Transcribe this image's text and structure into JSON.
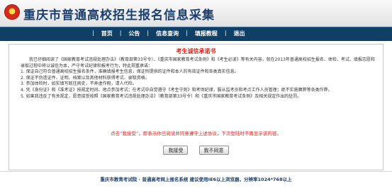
{
  "header": {
    "title": "重庆市普通高校招生报名信息采集"
  },
  "nav": {
    "items": [
      {
        "label": "首页"
      },
      {
        "label": "公告"
      },
      {
        "label": "信息查询"
      },
      {
        "label": "填报教程"
      },
      {
        "label": "退出"
      }
    ]
  },
  "notice": {
    "title": "考生诚信承诺书",
    "paragraphs": [
      "我已仔细阅读了《国家教育考试违规处理办法》（教育部第33号令）、《重庆市国家教育考试条例》和《考生必读》等有关内容，就在2013年普通高校招生报名、体检、考试、填报志愿和录取过程中将以诚信为本，严守考试纪律和报考行为，特此郑重承诺：",
      "1. 保证自己符合普通高校招生报名条件，准确填报考生信息，保证所提供的证件和本人的有效证件和各类真实信息。",
      "2. 保证不伪造证件、证明、档案以及其他材料获得考试、录取资格。",
      "3. 参加体检时，如实填写既往病史，不弄虚作假，请人代检。",
      "4. 凭《身份证》和《准考证》按规定时间、地点参加考试；在考试中自觉遵守《考生守则》和考场纪律，服从监考员和考点工作人员管理；绝不实施舞弊等各类作弊。",
      "5. 如果我违反了有关规定，愿意接受按照《国家教育考试违规处理办法》（教育部第33号令）和《重庆市国家教育考试条例》及相关规定作出的处罚。"
    ],
    "tip": "点击“我接受”，即表示你已阅读并同意遵守上述协议，下次登陆时不再显示该内容。",
    "accept_label": "我接受",
    "decline_label": "我不同意"
  },
  "footer": {
    "text": "重庆市教育考试院 · 普通高考网上报名系统    建议使用IE6以上浏览器，分辨率1024*768以上"
  },
  "colors": {
    "title": "#1a3e6e",
    "nav_bg": "#103f66",
    "accent_red": "#d4221a"
  }
}
